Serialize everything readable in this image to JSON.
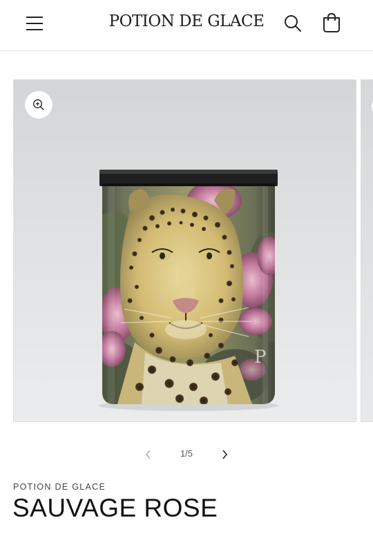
{
  "header": {
    "logo": "POTION DE GLACE",
    "icons": {
      "menu": "hamburger-menu-icon",
      "search": "search-icon",
      "cart": "shopping-bag-icon"
    }
  },
  "gallery": {
    "image_description_icon": "leopard-candle-jar-image",
    "zoom_icon": "zoom-in-icon",
    "counter_current": "1",
    "counter_total": "5",
    "counter_text": "1/5"
  },
  "product": {
    "vendor": "POTION DE GLACE",
    "title": "SAUVAGE ROSE"
  },
  "colors": {
    "text": "#121212",
    "border": "#e8e8e8",
    "image_bg": "#dfe1e2",
    "flower_pink": "#c77aa0"
  }
}
